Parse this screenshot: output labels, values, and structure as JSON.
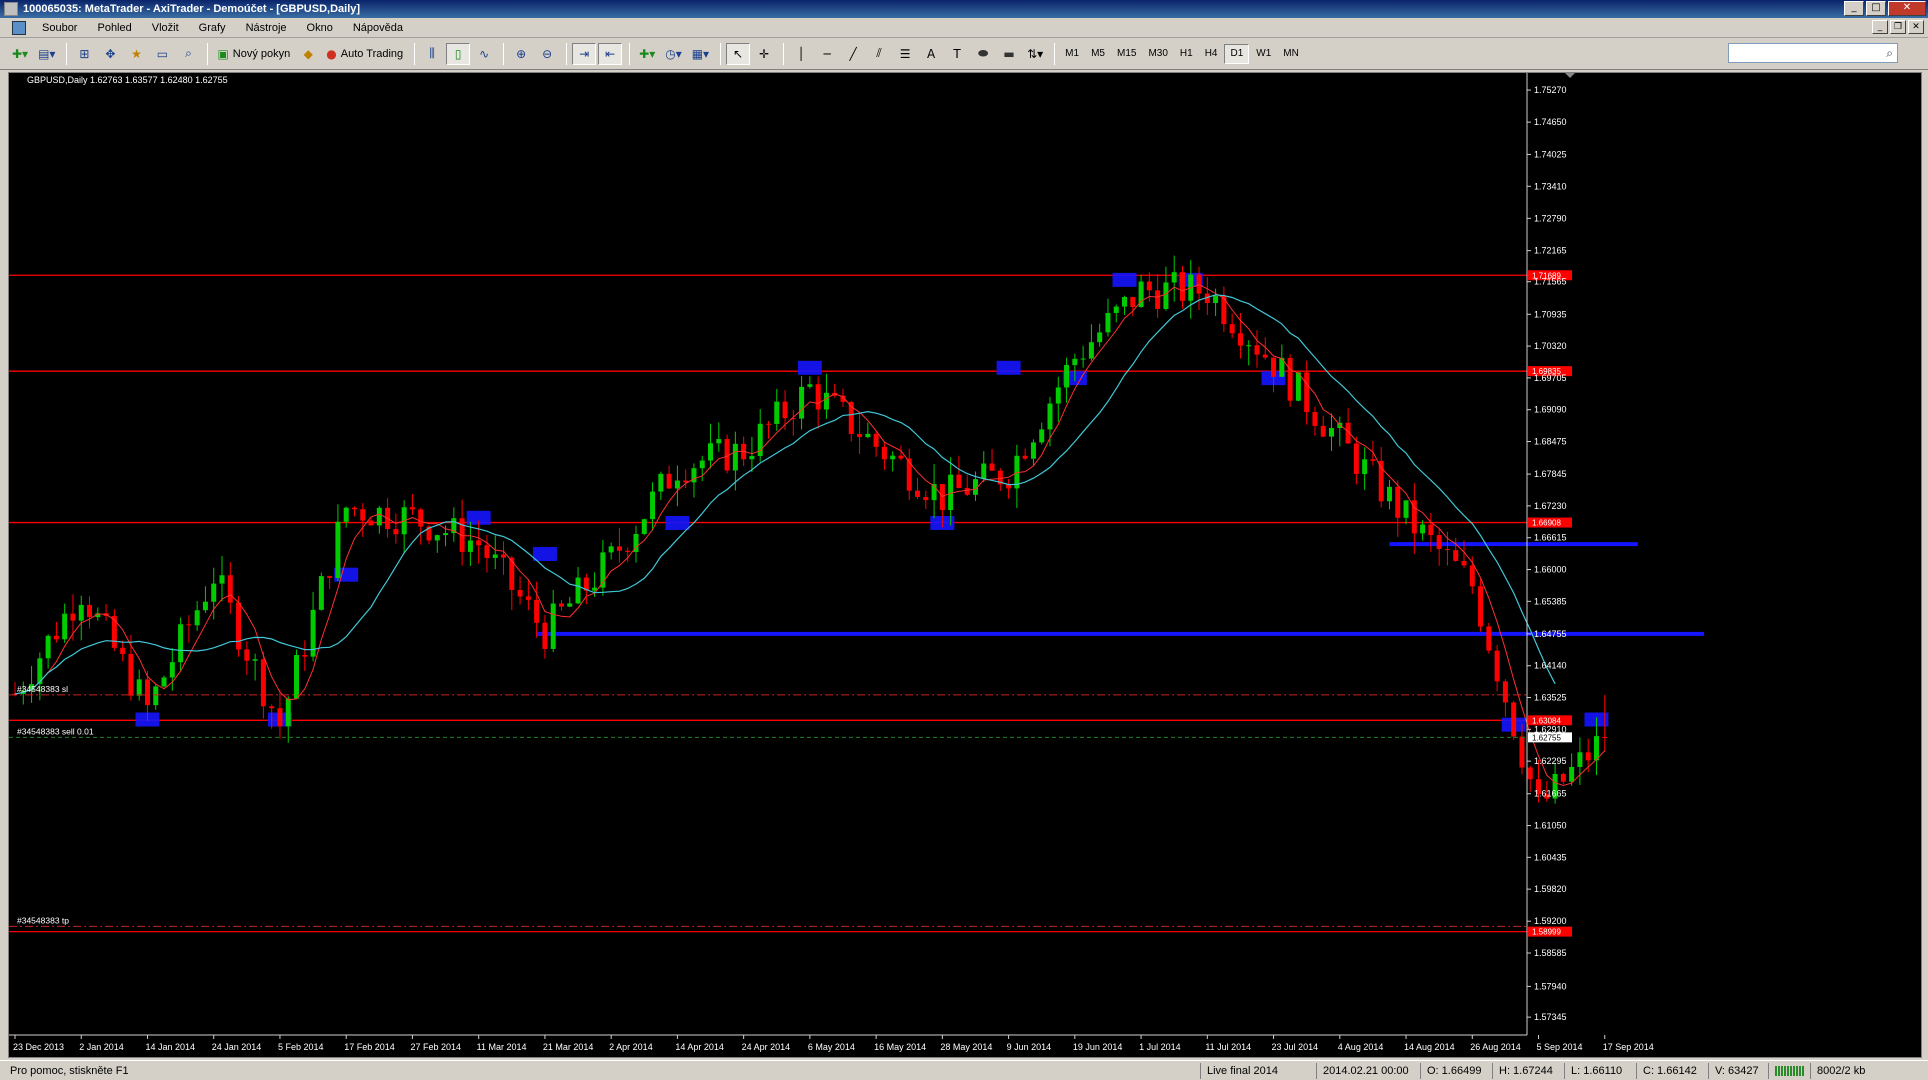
{
  "window": {
    "title": "100065035: MetaTrader - AxiTrader - Demoúčet - [GBPUSD,Daily]",
    "min_label": "_",
    "max_label": "□",
    "close_label": "✕"
  },
  "menu": {
    "items": [
      "Soubor",
      "Pohled",
      "Vložit",
      "Grafy",
      "Nástroje",
      "Okno",
      "Nápověda"
    ],
    "mdi_min": "_",
    "mdi_restore": "❐",
    "mdi_close": "✕"
  },
  "toolbar": {
    "new_order_label": "Nový pokyn",
    "auto_trading_label": "Auto Trading",
    "timeframes": [
      "M1",
      "M5",
      "M15",
      "M30",
      "H1",
      "H4",
      "D1",
      "W1",
      "MN"
    ],
    "active_timeframe": "D1",
    "search_placeholder": ""
  },
  "chart": {
    "header": "GBPUSD,Daily  1.62763 1.63577 1.62480 1.62755",
    "background": "#000000",
    "bull_color": "#00cc00",
    "bear_color": "#ff0000",
    "ma_fast_color": "#ff3030",
    "ma_slow_color": "#40c8d8",
    "level_color": "#ff0000",
    "zone_color": "#1515ff",
    "price_labels": [
      "1.75270",
      "1.74650",
      "1.74025",
      "1.73410",
      "1.72790",
      "1.72165",
      "1.71565",
      "1.70935",
      "1.70320",
      "1.69705",
      "1.69090",
      "1.68475",
      "1.67845",
      "1.67230",
      "1.66615",
      "1.66000",
      "1.65385",
      "1.64755",
      "1.64140",
      "1.63525",
      "1.62910",
      "1.62295",
      "1.61665",
      "1.61050",
      "1.60435",
      "1.59820",
      "1.59200",
      "1.58585",
      "1.57940",
      "1.57345"
    ],
    "date_labels": [
      "23 Dec 2013",
      "2 Jan 2014",
      "14 Jan 2014",
      "24 Jan 2014",
      "5 Feb 2014",
      "17 Feb 2014",
      "27 Feb 2014",
      "11 Mar 2014",
      "21 Mar 2014",
      "2 Apr 2014",
      "14 Apr 2014",
      "24 Apr 2014",
      "6 May 2014",
      "16 May 2014",
      "28 May 2014",
      "9 Jun 2014",
      "19 Jun 2014",
      "1 Jul 2014",
      "11 Jul 2014",
      "23 Jul 2014",
      "4 Aug 2014",
      "14 Aug 2014",
      "26 Aug 2014",
      "5 Sep 2014",
      "17 Sep 2014"
    ],
    "horizontal_levels": [
      {
        "price": 1.71689,
        "label": "1.71689"
      },
      {
        "price": 1.69835,
        "label": "1.69835"
      },
      {
        "price": 1.66908,
        "label": "1.66908"
      },
      {
        "price": 1.63084,
        "label": "1.63084"
      },
      {
        "price": 1.58999,
        "label": "1.58999"
      }
    ],
    "current_price": {
      "price": 1.62755,
      "label": "1.62755"
    },
    "order_lines": [
      {
        "price": 1.63577,
        "label": "#34548383 sl",
        "style": "dashdot",
        "color": "#cc2222"
      },
      {
        "price": 1.62755,
        "label": "#34548383 sell 0.01",
        "style": "dashed",
        "color": "#208020"
      },
      {
        "price": 1.591,
        "label": "#34548383 tp",
        "style": "dashdot",
        "color": "#cc2222"
      }
    ],
    "support_lines": [
      {
        "price": 1.64755,
        "from": "20 Mar 2014",
        "to": "3 Oct 2014"
      },
      {
        "price": 1.6649,
        "from": "12 Aug 2014",
        "to": "23 Sep 2014"
      }
    ]
  },
  "chart_data": {
    "type": "candlestick",
    "symbol": "GBPUSD",
    "timeframe": "Daily",
    "ylim": [
      1.57,
      1.756
    ],
    "last_bar": {
      "open": 1.62763,
      "high": 1.63577,
      "low": 1.6248,
      "close": 1.62755
    },
    "ohlc_path": [
      [
        "23 Dec 2013",
        1.636
      ],
      [
        "2 Jan 2014",
        1.656
      ],
      [
        "14 Jan 2014",
        1.633
      ],
      [
        "24 Jan 2014",
        1.659
      ],
      [
        "5 Feb 2014",
        1.63
      ],
      [
        "17 Feb 2014",
        1.672
      ],
      [
        "27 Feb 2014",
        1.67
      ],
      [
        "11 Mar 2014",
        1.665
      ],
      [
        "21 Mar 2014",
        1.648
      ],
      [
        "2 Apr 2014",
        1.662
      ],
      [
        "14 Apr 2014",
        1.68
      ],
      [
        "24 Apr 2014",
        1.683
      ],
      [
        "6 May 2014",
        1.695
      ],
      [
        "16 May 2014",
        1.684
      ],
      [
        "28 May 2014",
        1.674
      ],
      [
        "9 Jun 2014",
        1.679
      ],
      [
        "19 Jun 2014",
        1.701
      ],
      [
        "1 Jul 2014",
        1.714
      ],
      [
        "11 Jul 2014",
        1.714
      ],
      [
        "23 Jul 2014",
        1.7
      ],
      [
        "4 Aug 2014",
        1.685
      ],
      [
        "14 Aug 2014",
        1.67
      ],
      [
        "26 Aug 2014",
        1.657
      ],
      [
        "5 Sep 2014",
        1.614
      ],
      [
        "17 Sep 2014",
        1.6276
      ]
    ]
  },
  "status": {
    "help": "Pro pomoc, stiskněte F1",
    "profile": "Live final 2014",
    "datetime": "2014.02.21 00:00",
    "open": "O: 1.66499",
    "high": "H: 1.67244",
    "low": "L: 1.66110",
    "close": "C: 1.66142",
    "volume": "V: 63427",
    "traffic": "8002/2 kb"
  }
}
